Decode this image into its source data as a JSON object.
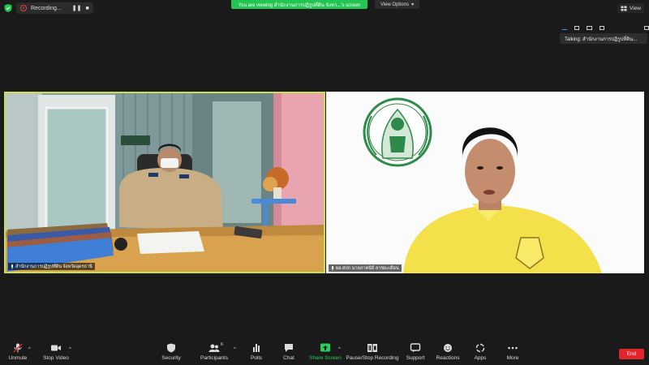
{
  "top": {
    "recording_label": "Recording...",
    "pause_glyph": "❚❚",
    "stop_glyph": "■",
    "viewing_banner": "You are viewing สำนักงานการปฏิรูปที่ดิน จังหว...'s screen",
    "view_options_label": "View Options",
    "view_options_caret": "▾",
    "view_label": "View",
    "talking_label": "Talking: สำนักงานการปฏิรูปที่ดิน..."
  },
  "tiles": {
    "left_name": "สำนักงานการปฏิรูปที่ดิน จังหวัดอุดรธานี",
    "right_name": "ผอ.สปก.นายภาคนีย์ ลาชยะเดือน"
  },
  "toolbar": {
    "unmute": "Unmute",
    "stop_video": "Stop Video",
    "security": "Security",
    "participants": "Participants",
    "participants_count": "6",
    "polls": "Polls",
    "chat": "Chat",
    "share_screen": "Share Screen",
    "pause_stop_recording": "Pause/Stop Recording",
    "support": "Support",
    "reactions": "Reactions",
    "apps": "Apps",
    "more": "More",
    "end": "End",
    "caret": "^"
  },
  "colors": {
    "background": "#1a1a1a",
    "share_green": "#23c552",
    "active_speaker_border": "#c9e04c",
    "end_red": "#e0262c"
  }
}
